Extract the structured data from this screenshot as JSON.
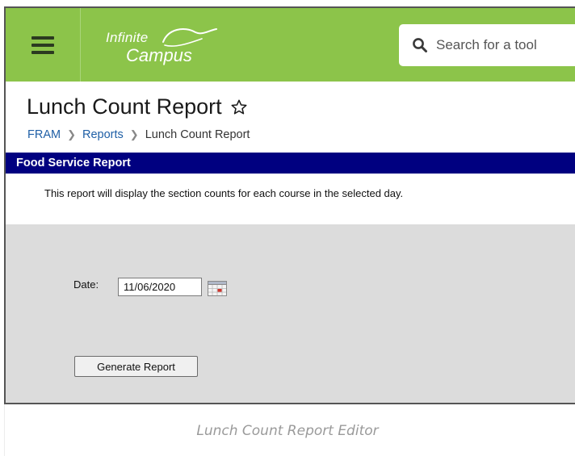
{
  "header": {
    "menu_icon": "hamburger-menu-icon",
    "logo_line1": "Infinite",
    "logo_line2": "Campus",
    "search_placeholder": "Search for a tool",
    "search_icon": "search-icon",
    "brand_color": "#8cc44a"
  },
  "page": {
    "title": "Lunch Count Report",
    "favorite_icon": "star-outline-icon",
    "breadcrumb": [
      "FRAM",
      "Reports",
      "Lunch Count Report"
    ]
  },
  "report": {
    "section_title": "Food Service Report",
    "section_bar_color": "#000080",
    "description": "This report will display the section counts for each course in the selected day.",
    "date_label": "Date:",
    "date_value": "11/06/2020",
    "calendar_icon": "calendar-icon",
    "generate_button": "Generate Report"
  },
  "caption": "Lunch Count Report Editor"
}
